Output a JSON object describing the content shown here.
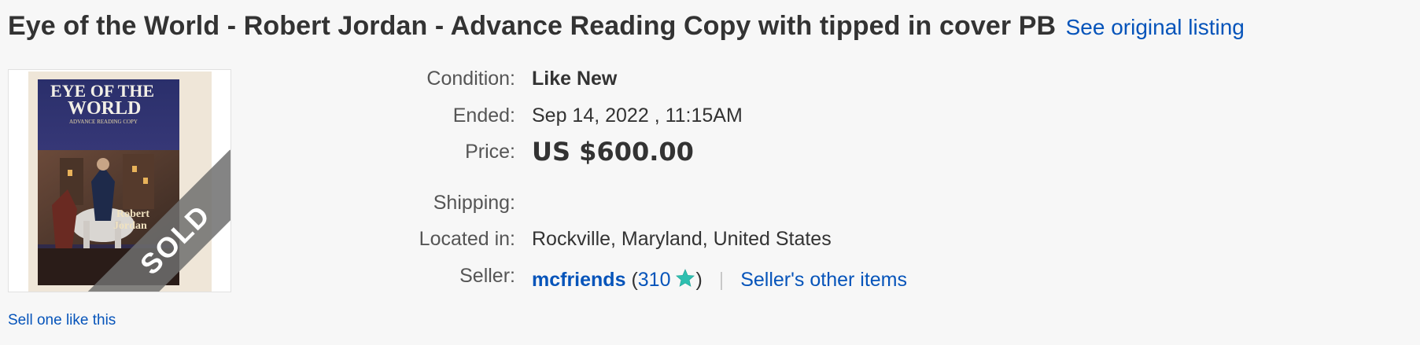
{
  "listing": {
    "title": "Eye of the World - Robert Jordan - Advance Reading Copy with tipped in cover PB",
    "see_original_label": "See original listing"
  },
  "image": {
    "alt": "Eye of the World advance reading copy book cover",
    "cover_title_line1": "EYE OF THE",
    "cover_title_line2": "WORLD",
    "cover_subtitle": "ADVANCE READING COPY",
    "cover_author_line1": "Robert",
    "cover_author_line2": "Jordan",
    "sold_badge": "SOLD"
  },
  "sell_one_label": "Sell one like this",
  "details": {
    "condition_label": "Condition:",
    "condition_value": "Like New",
    "ended_label": "Ended:",
    "ended_value": "Sep 14, 2022 , 11:15AM",
    "price_label": "Price:",
    "price_value": "US $600.00",
    "shipping_label": "Shipping:",
    "shipping_value": "",
    "location_label": "Located in:",
    "location_value": "Rockville, Maryland, United States",
    "seller_label": "Seller:",
    "seller_name": "mcfriends",
    "feedback_open": "(",
    "feedback_score": "310",
    "feedback_close": ")",
    "feedback_star_icon": "teal-star-icon",
    "separator": "|",
    "seller_other_items": "Seller's other items"
  },
  "colors": {
    "link": "#0654ba",
    "star": "#2dbfb0",
    "background": "#f7f7f7"
  }
}
